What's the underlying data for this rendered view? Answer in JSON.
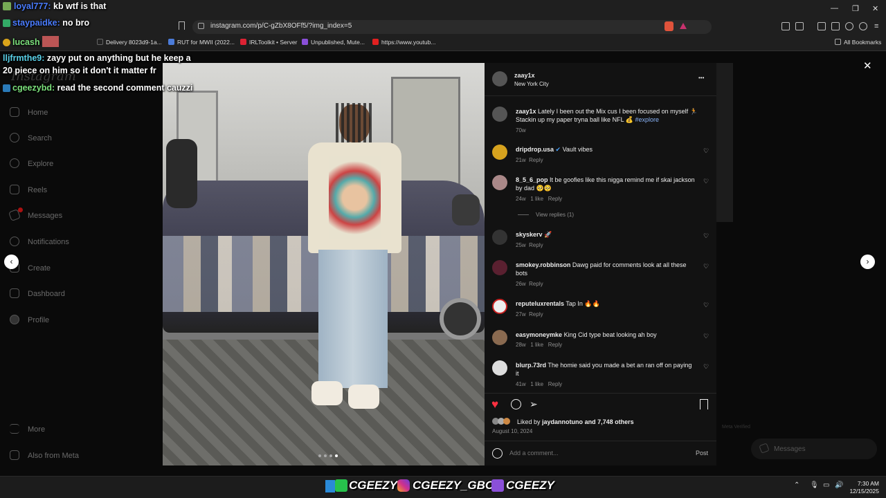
{
  "browser": {
    "url": "instagram.com/p/C-gZbX8OFf5/?img_index=5",
    "bookmarks": [
      {
        "label": "Delivery 8023d9-1a..."
      },
      {
        "label": "RUT for MWII (2022..."
      },
      {
        "label": "IRLToolkit • Server"
      },
      {
        "label": "Unpublished, Mute..."
      },
      {
        "label": "https://www.youtub..."
      }
    ],
    "all_bookmarks": "All Bookmarks",
    "colors": {
      "chrome": "#1f1f1f",
      "accent": "#e53935"
    }
  },
  "sidebar": {
    "logo": "Instagram",
    "items": [
      {
        "label": "Home",
        "icon": "home-icon"
      },
      {
        "label": "Search",
        "icon": "search-icon"
      },
      {
        "label": "Explore",
        "icon": "explore-icon"
      },
      {
        "label": "Reels",
        "icon": "reels-icon"
      },
      {
        "label": "Messages",
        "icon": "messages-icon"
      },
      {
        "label": "Notifications",
        "icon": "heart-icon"
      },
      {
        "label": "Create",
        "icon": "plus-icon"
      },
      {
        "label": "Dashboard",
        "icon": "dashboard-icon"
      },
      {
        "label": "Profile",
        "icon": "avatar-icon"
      }
    ],
    "more": "More",
    "also_from_meta": "Also from Meta"
  },
  "post": {
    "username": "zaay1x",
    "location": "New York City",
    "caption": {
      "user": "zaay1x",
      "text": "Lately I been out the Mix cus I been focused on myself 🏃 Stackin up my paper tryna ball like NFL 💰",
      "tag": "#explore",
      "time": "70w"
    },
    "comments": [
      {
        "user": "dripdrop.usa",
        "verified": "✔",
        "text": "Vault vibes",
        "time": "21w",
        "likes": "",
        "reply": "Reply"
      },
      {
        "user": "8_5_6_pop",
        "text": "It be goofies like this nigga remind me if skai jackson by dad 🥺🥺",
        "time": "24w",
        "likes": "1 like",
        "reply": "Reply"
      },
      {
        "user": "skyskerv",
        "text": "🚀",
        "time": "25w",
        "likes": "",
        "reply": "Reply"
      },
      {
        "user": "smokey.robbinson",
        "text": "Dawg paid for comments look at all these bots",
        "time": "26w",
        "likes": "",
        "reply": "Reply"
      },
      {
        "user": "reputeluxrentals",
        "text": "Tap In 🔥🔥",
        "time": "27w",
        "likes": "",
        "reply": "Reply"
      },
      {
        "user": "easymoneymke",
        "text": "King Cid type beat looking ah boy",
        "time": "28w",
        "likes": "1 like",
        "reply": "Reply"
      },
      {
        "user": "blurp.73rd",
        "text": "The homie said you made a bet an ran off on paying it",
        "time": "41w",
        "likes": "1 like",
        "reply": "Reply"
      }
    ],
    "view_replies": "View replies (1)",
    "liked_by_prefix": "Liked by",
    "liked_by_user": "jaydannotuno",
    "liked_by_suffix": "and 7,748 others",
    "date": "August 10, 2024",
    "add_comment_placeholder": "Add a comment...",
    "post_button": "Post",
    "more_icon": "•••",
    "close_icon": "✕"
  },
  "meta_verified": "Meta Verified",
  "messages_pill": "Messages",
  "chat": [
    {
      "user": "loyal777:",
      "text": "kb wtf is that",
      "color": "#4a7cff"
    },
    {
      "user": "staypaidke:",
      "text": "no bro",
      "color": "#4a7cff"
    },
    {
      "user": "lucash",
      "text": "",
      "color": "#7be07b"
    },
    {
      "user": "lljfrmthe9:",
      "text": "zayy put on anything but he keep a",
      "color": "#5ad1e8"
    },
    {
      "user": "",
      "text": "20 piece on him so it don't it matter fr",
      "color": "#fff"
    },
    {
      "user": "cgeezybd:",
      "text": "read the second comment cauzzi",
      "color": "#7be07b"
    }
  ],
  "banner": {
    "handles": [
      "CGEEZY",
      "CGEEZY_GBC",
      "CGEEZY"
    ]
  },
  "tray": {
    "time": "7:30 AM",
    "date": "12/15/2025"
  }
}
